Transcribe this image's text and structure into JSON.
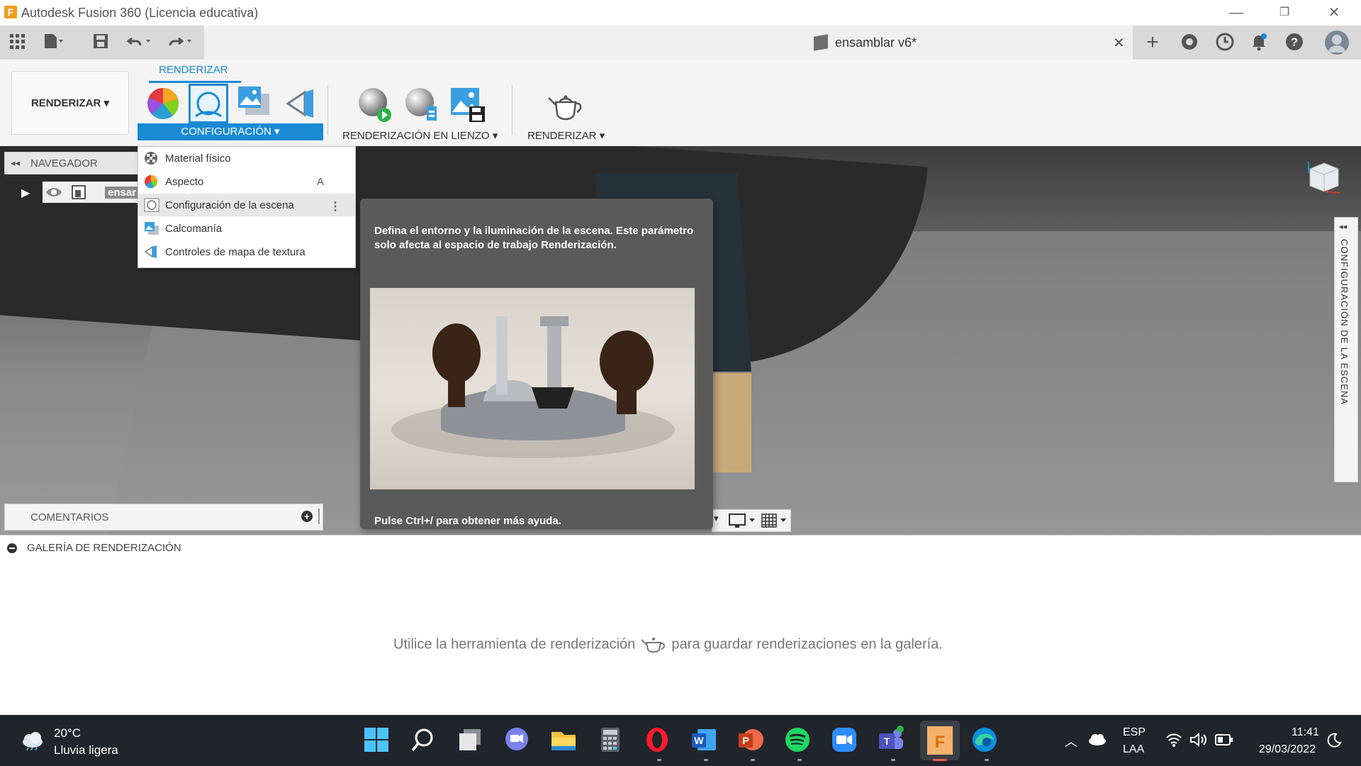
{
  "window": {
    "title": "Autodesk Fusion 360 (Licencia educativa)",
    "logo_letter": "F",
    "minimize": "—",
    "restore": "❐",
    "close": "✕"
  },
  "tabbar": {
    "document_title": "ensamblar v6*",
    "close_tab": "✕",
    "new_tab": "+"
  },
  "ribbon": {
    "workspace_button": "RENDERIZAR ▾",
    "active_tab": "RENDERIZAR",
    "groups": {
      "configuracion": "CONFIGURACIÓN ▾",
      "renderizacion_en_lienzo": "RENDERIZACIÓN EN LIENZO ▾",
      "renderizar": "RENDERIZAR ▾"
    }
  },
  "navigator": {
    "title": "NAVEGADOR",
    "collapse": "◂◂",
    "root_item": "ensar"
  },
  "dropdown": {
    "items": [
      {
        "label": "Material físico",
        "shortcut": ""
      },
      {
        "label": "Aspecto",
        "shortcut": "A"
      },
      {
        "label": "Configuración de la escena",
        "shortcut": "⋮"
      },
      {
        "label": "Calcomanía",
        "shortcut": ""
      },
      {
        "label": "Controles de mapa de textura",
        "shortcut": ""
      }
    ]
  },
  "tooltip": {
    "description": "Defina el entorno y la iluminación de la escena. Este parámetro solo afecta al espacio de trabajo Renderización.",
    "footer": "Pulse Ctrl+/ para obtener más ayuda."
  },
  "scene_panel": {
    "label": "CONFIGURACIÓN DE LA ESCENA",
    "collapse": "◂◂"
  },
  "comments": {
    "label": "COMENTARIOS",
    "add": "+"
  },
  "gallery": {
    "title": "GALERÍA DE RENDERIZACIÓN",
    "message_before": "Utilice la herramienta de renderización",
    "message_after": "para guardar renderizaciones en la galería."
  },
  "taskbar": {
    "weather_temp": "20°C",
    "weather_desc": "Lluvia ligera",
    "lang_top": "ESP",
    "lang_bottom": "LAA",
    "time": "11:41",
    "date": "29/03/2022"
  },
  "colors": {
    "accent": "#1a8ad4",
    "fusion_orange": "#f29b1d",
    "taskbar": "#20242b"
  }
}
